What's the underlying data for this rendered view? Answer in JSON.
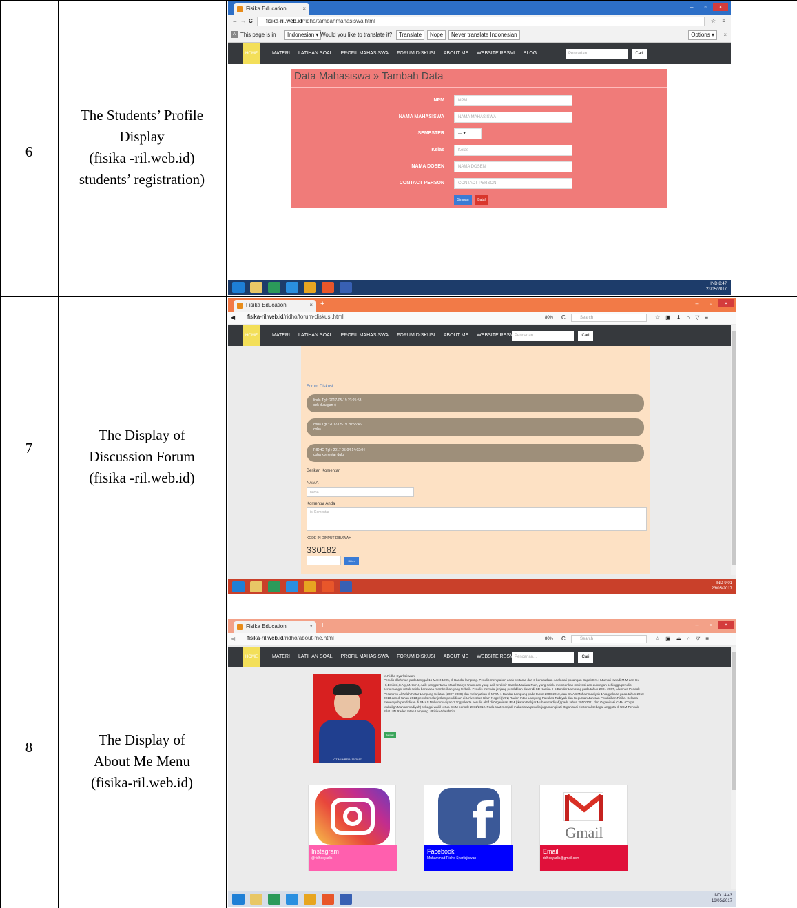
{
  "rows": [
    {
      "number": "6",
      "desc_lines": [
        "The Students’ Profile",
        "Display",
        "(fisika -ril.web.id)",
        "students’ registration)"
      ],
      "screen": {
        "tab_title": "Fisika Education",
        "url_domain": "fisika-ril.web.id",
        "url_path": "/ridho/tambahmahasiswa.html",
        "translate_bar": {
          "prefix": "This page is in",
          "language": "Indonesian ▾",
          "question": "Would you like to translate it?",
          "translate_btn": "Translate",
          "nope_btn": "Nope",
          "never_btn": "Never translate Indonesian",
          "options_btn": "Options ▾"
        },
        "nav": {
          "home": "HOME",
          "items": [
            "MATERI",
            "LATIHAN SOAL",
            "PROFIL MAHASISWA",
            "FORUM DISKUSI",
            "ABOUT ME",
            "WEBSITE RESMI",
            "BLOG"
          ],
          "search_placeholder": "Pencarian...",
          "search_btn": "Cari"
        },
        "form_title": "Data Mahasiswa » Tambah Data",
        "fields": [
          {
            "label": "NPM",
            "placeholder": "NPM"
          },
          {
            "label": "NAMA MAHASISWA",
            "placeholder": "NAMA MAHASISWA"
          },
          {
            "label": "SEMESTER",
            "placeholder": "--- ▾"
          },
          {
            "label": "Kelas",
            "placeholder": "Kelas"
          },
          {
            "label": "NAMA DOSEN",
            "placeholder": "NAMA DOSEN"
          },
          {
            "label": "CONTACT PERSON",
            "placeholder": "CONTACT PERSON"
          }
        ],
        "save_btn": "Simpan",
        "cancel_btn": "Batal",
        "tray_time": "8:47",
        "tray_date": "23/05/2017",
        "tray_lang": "IND"
      }
    },
    {
      "number": "7",
      "desc_lines": [
        "The Display of",
        "Discussion Forum",
        "(fisika -ril.web.id)"
      ],
      "screen": {
        "tab_title": "Fisika Education",
        "url_domain": "fisika-ril.web.id",
        "url_path": "/ridho/forum-diskusi.html",
        "zoom": "80%",
        "search_placeholder": "Search",
        "nav": {
          "home": "HOME",
          "items": [
            "MATERI",
            "LATIHAN SOAL",
            "PROFIL MAHASISWA",
            "FORUM DISKUSI",
            "ABOUT ME",
            "WEBSITE RESMI",
            "BLOG"
          ],
          "search_placeholder": "Pencarian...",
          "search_btn": "Cari"
        },
        "forum_heading": "Forum Diskusi ...",
        "comments": [
          {
            "header": "linda Tgl : 2017-05-19 23:25:53",
            "body": "cek dulu gan :)"
          },
          {
            "header": "coba Tgl : 2017-05-19 20:55:46",
            "body": "coba"
          },
          {
            "header": "RIDHO Tgl : 2017-05-04 14:02:04",
            "body": "coba komentar dulu"
          }
        ],
        "give_comment": "Berikan Komentar",
        "name_label": "NAMA",
        "name_placeholder": "nama",
        "comment_label": "Komentar Anda",
        "comment_placeholder": "isi Komentar",
        "code_label": "KODE IN DINPUT DIBAWAH",
        "captcha": "330182",
        "send_btn": "Kirim",
        "tray_time": "9:01",
        "tray_date": "23/05/2017",
        "tray_lang": "IND"
      }
    },
    {
      "number": "8",
      "desc_lines": [
        "The Display of",
        "About Me Menu",
        "(fisika-ril.web.id)"
      ],
      "screen": {
        "tab_title": "Fisika Education",
        "url_domain": "fisika-ril.web.id",
        "url_path": "/ridho/about-me.html",
        "zoom": "80%",
        "search_placeholder": "Search",
        "nav": {
          "home": "HOME",
          "items": [
            "MATERI",
            "LATIHAN SOAL",
            "PROFIL MAHASISWA",
            "FORUM DISKUSI",
            "ABOUT ME",
            "WEBSITE RESMI",
            "BLOG"
          ],
          "search_placeholder": "Pencarian...",
          "search_btn": "Cari"
        },
        "bio_name": "M.Ridho Syarlisjiswan",
        "bio_text": "Penulis dilahirkan pada tanggal 15 Maret 1995, di Bandar lampung. Penulis merupakan anak pertama dari 3 bersaudara. Anak dari pasangan Bapak Drs.H.Jumari Iswadi,M.M dan Ibu Hj.Emilasi,S.Ag.,M.Kom.I, Adik yang pertama M.Lail Cahya Utum dan yang adik terakhir Cantika Mutiara Putri, yang selalu memberikan motivasi dan dukungan sehingga penulis bersemangat untuk selalu berusaha memberikan yang terbaik. Penulis memulai jenjang pendidikan dasar di SD Kartika II-5 Bandar Lampung pada tahun 2001-2007, Alumnus Pondok Pesantren Al Falah Natar Lampung Selatan (2007-2008) dan melanjutkan di MTsN 1 Bandar Lampung pada tahun 2008-2010, dan SMAS Muhammadiyah 1 Yogyakarta pada tahun 2010-2013 dan di tahun 2013 penulis melanjutkan pendidikan di Universitas Islam Negeri (UIN) Raden Intan Lampung Fakultas Tarbiyah dan Keguruan Jurusan Pendidikan Fisika. Selama menempuh pendidikan di SMAS Muhammadiyah 1 Yogyakarta penulis aktif di Organisasi IPM (Ikatan Pelajar Muhammadiyah) pada tahun 2010/2011 dan Organisasi CMM (Corps Mubaligh Muhammadiyah) sebagai wakil ketua CMM periode 2011/2012. Pada saat menjadi mahasiswa penulis juga mengikuti Organisasi eksternal sebagai anggota di UKM Pencak Silat UIN Raden Intan Lampung. #FisikaAdalahKita",
        "photo_caption": "ICT-NUMBER: 16 2017",
        "back_btn": "Kembali",
        "social": [
          {
            "name": "Instagram",
            "handle": "@ridhosyarlis",
            "color": "#ff5fae",
            "icon": "instagram-icon"
          },
          {
            "name": "Facebook",
            "handle": "Muhammad Ridho Syarlisjiswan",
            "color": "#0000ff",
            "icon": "facebook-icon"
          },
          {
            "name": "Email",
            "handle": "ridhosyarlis@gmail.com",
            "color": "#e0103a",
            "icon": "gmail-icon"
          }
        ],
        "gmail_word": "Gmail",
        "tray_time": "14:43",
        "tray_date": "16/05/2017",
        "tray_lang": "IND"
      }
    }
  ]
}
